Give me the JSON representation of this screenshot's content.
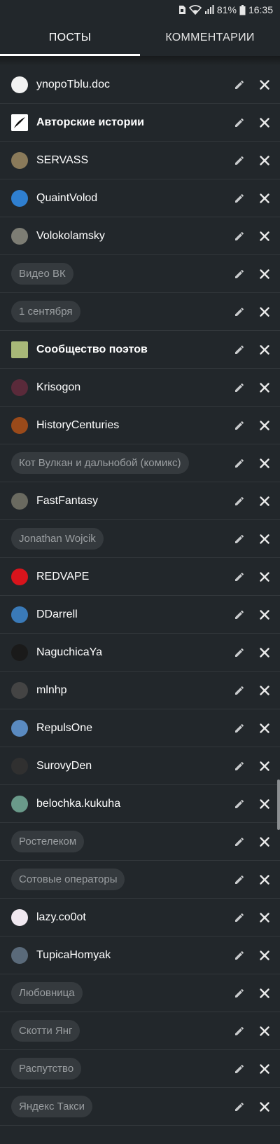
{
  "status": {
    "battery_percent": "81%",
    "time": "16:35"
  },
  "tabs": [
    {
      "label": "ПОСТЫ",
      "active": true
    },
    {
      "label": "КОММЕНТАРИИ",
      "active": false
    }
  ],
  "items": [
    {
      "type": "user",
      "name": "ynopoTblu.doc",
      "avatar_color": "#f2f2f2",
      "bold": false
    },
    {
      "type": "community",
      "name": "Авторские истории",
      "avatar_color": "#ffffff",
      "bold": true
    },
    {
      "type": "user",
      "name": "SERVASS",
      "avatar_color": "#8a7a5a",
      "bold": false
    },
    {
      "type": "user",
      "name": "QuaintVolod",
      "avatar_color": "#2f7fd0",
      "bold": false
    },
    {
      "type": "user",
      "name": "Volokolamsky",
      "avatar_color": "#7d7d74",
      "bold": false
    },
    {
      "type": "tag",
      "name": "Видео ВК"
    },
    {
      "type": "tag",
      "name": "1 сентября"
    },
    {
      "type": "community",
      "name": "Сообщество поэтов",
      "avatar_color": "#a8b878",
      "bold": true
    },
    {
      "type": "user",
      "name": "Krisogon",
      "avatar_color": "#5a2a3a",
      "bold": false
    },
    {
      "type": "user",
      "name": "HistoryCenturies",
      "avatar_color": "#9a4a1a",
      "bold": false
    },
    {
      "type": "tag",
      "name": "Кот Вулкан и дальнобой (комикс)"
    },
    {
      "type": "user",
      "name": "FastFantasy",
      "avatar_color": "#6a6a60",
      "bold": false
    },
    {
      "type": "tag",
      "name": "Jonathan Wojcik"
    },
    {
      "type": "user",
      "name": "REDVAPE",
      "avatar_color": "#d8141c",
      "bold": false
    },
    {
      "type": "user",
      "name": "DDarrell",
      "avatar_color": "#3a7ab8",
      "bold": false
    },
    {
      "type": "user",
      "name": "NaguchicaYa",
      "avatar_color": "#1a1a1a",
      "bold": false
    },
    {
      "type": "user",
      "name": "mlnhp",
      "avatar_color": "#444444",
      "bold": false
    },
    {
      "type": "user",
      "name": "RepulsOne",
      "avatar_color": "#5a8ac0",
      "bold": false
    },
    {
      "type": "user",
      "name": "SurovyDen",
      "avatar_color": "#303030",
      "bold": false
    },
    {
      "type": "user",
      "name": "belochka.kukuha",
      "avatar_color": "#6a9a8a",
      "bold": false
    },
    {
      "type": "tag",
      "name": "Ростелеком"
    },
    {
      "type": "tag",
      "name": "Сотовые операторы"
    },
    {
      "type": "user",
      "name": "lazy.co0ot",
      "avatar_color": "#f0e8f0",
      "bold": false
    },
    {
      "type": "user",
      "name": "TupicaHomyak",
      "avatar_color": "#5a6a7a",
      "bold": false
    },
    {
      "type": "tag",
      "name": "Любовница"
    },
    {
      "type": "tag",
      "name": "Скотти Янг"
    },
    {
      "type": "tag",
      "name": "Распутство"
    },
    {
      "type": "tag",
      "name": "Яндекс Такси"
    }
  ]
}
